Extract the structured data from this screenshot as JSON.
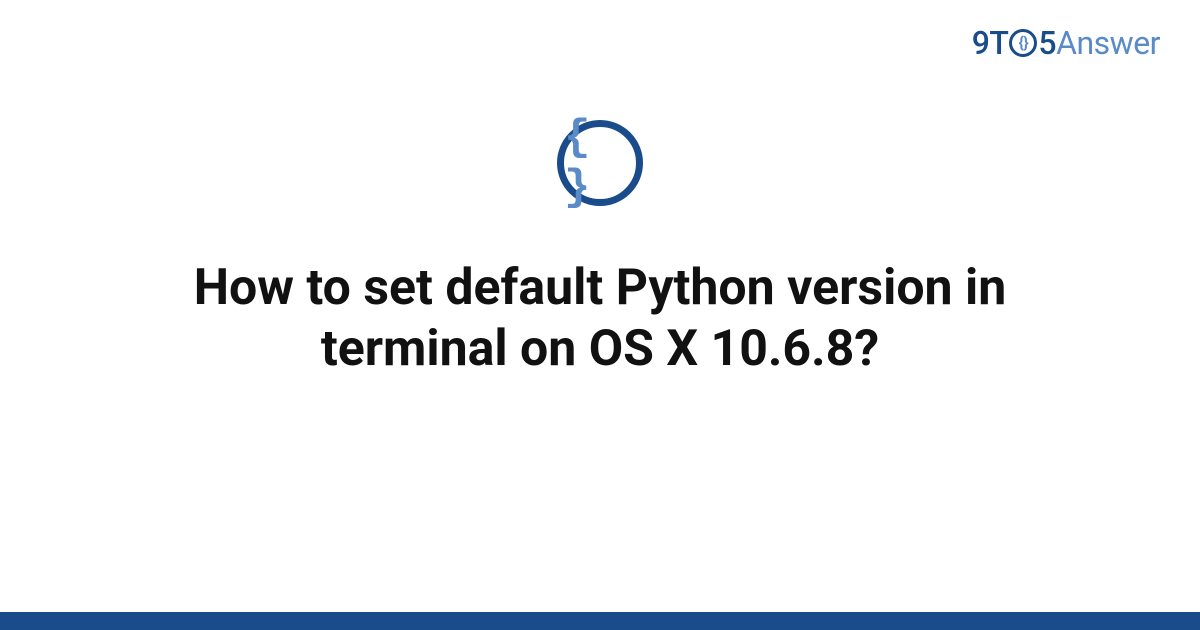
{
  "logo": {
    "part1": "9T",
    "o_inner": "{}",
    "part2": "5",
    "part3": "Answer"
  },
  "icon": {
    "glyph": "{ }",
    "name": "code-braces-icon"
  },
  "title": "How to set default Python version in terminal on OS X 10.6.8?",
  "colors": {
    "brand_dark": "#1a4b8a",
    "brand_light": "#5a8ac8"
  }
}
